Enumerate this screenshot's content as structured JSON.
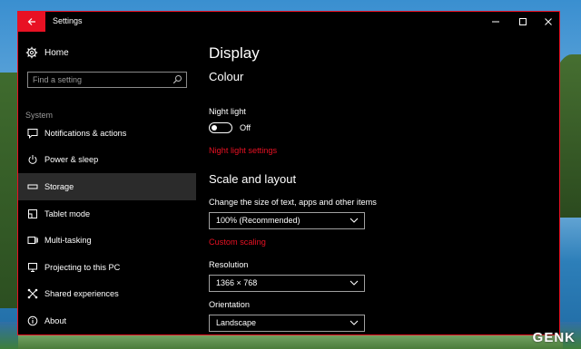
{
  "window": {
    "title": "Settings"
  },
  "sidebar": {
    "home_label": "Home",
    "search_placeholder": "Find a setting",
    "section": "System",
    "items": [
      {
        "label": "Notifications & actions",
        "icon": "notification-icon"
      },
      {
        "label": "Power & sleep",
        "icon": "power-icon"
      },
      {
        "label": "Storage",
        "icon": "storage-icon",
        "selected": true
      },
      {
        "label": "Tablet mode",
        "icon": "tablet-icon"
      },
      {
        "label": "Multi-tasking",
        "icon": "multitasking-icon"
      },
      {
        "label": "Projecting to this PC",
        "icon": "projecting-icon"
      },
      {
        "label": "Shared experiences",
        "icon": "shared-icon"
      },
      {
        "label": "About",
        "icon": "info-icon"
      }
    ]
  },
  "content": {
    "title": "Display",
    "colour": {
      "heading": "Colour",
      "night_light_label": "Night light",
      "night_light_state": "Off",
      "night_light_on": false,
      "night_light_link": "Night light settings"
    },
    "scale": {
      "heading": "Scale and layout",
      "size_label": "Change the size of text, apps and other items",
      "size_value": "100% (Recommended)",
      "custom_link": "Custom scaling",
      "resolution_label": "Resolution",
      "resolution_value": "1366 × 768",
      "orientation_label": "Orientation",
      "orientation_value": "Landscape"
    }
  },
  "colors": {
    "accent": "#e81123",
    "background": "#000000",
    "selected_nav": "#2b2b2b"
  },
  "watermark": {
    "text": "GENK"
  }
}
